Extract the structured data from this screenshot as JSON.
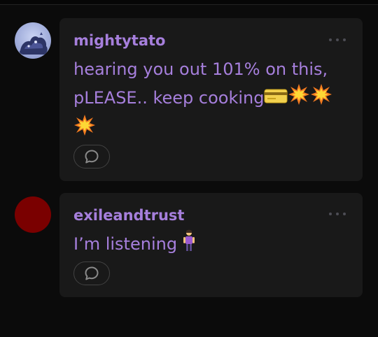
{
  "comments": [
    {
      "username": "mightytato",
      "text": "hearing you out 101% on this, pLEASE.. keep cooking",
      "emojis": [
        "credit-card-emoji",
        "collision-emoji",
        "collision-emoji",
        "collision-emoji"
      ],
      "avatar": "illustrated-avatar"
    },
    {
      "username": "exileandtrust",
      "text": "I’m listening",
      "emojis": [
        "person-standing-emoji"
      ],
      "avatar_color": "#7a0000"
    }
  ],
  "icons": {
    "more": "more-options-icon",
    "reply": "speech-bubble-icon"
  },
  "colors": {
    "accent": "#a67fdc",
    "card_bg": "#191919",
    "page_bg": "#0b0b0b"
  }
}
